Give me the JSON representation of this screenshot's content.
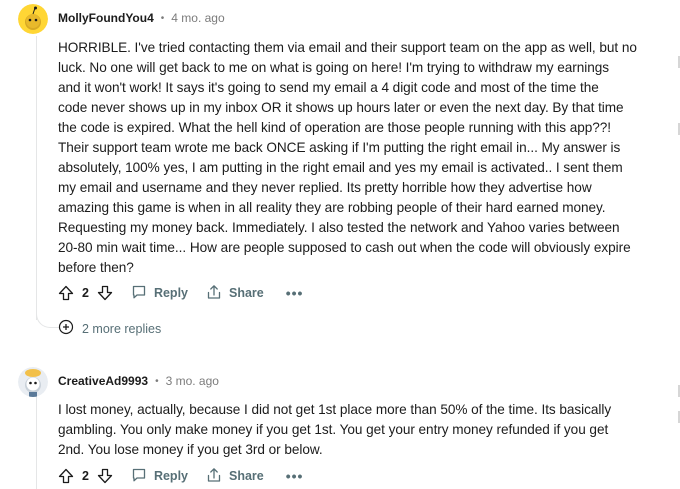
{
  "comments": [
    {
      "username": "MollyFoundYou4",
      "separator": "•",
      "time": "4 mo. ago",
      "avatar_icon": "yellow-snoo-avatar-icon",
      "body": "HORRIBLE. I've tried contacting them via email and their support team on the app as well, but no\nluck. No one will get back to me on what is going on here! I'm trying to withdraw my earnings\nand it won't work! It says it's going to send my email a 4 digit code and most of the time the\ncode never shows up in my inbox OR it shows up hours later or even the next day. By that time\nthe code is expired. What the hell kind of operation are those people running with this app??!\nTheir support team wrote me back ONCE asking if I'm putting the right email in... My answer is\nabsolutely, 100% yes, I am putting in the right email and yes my email is activated.. I sent them\nmy email and username and they never replied. Its pretty horrible how they advertise how\namazing this game is when in all reality they are robbing people of their hard earned money.\nRequesting my money back. Immediately. I also tested the network and Yahoo varies between\n20-80 min wait time... How are people supposed to cash out when the code will obviously expire\nbefore then?",
      "votes": "2",
      "reply_label": "Reply",
      "share_label": "Share",
      "more_label": "•••"
    },
    {
      "username": "CreativeAd9993",
      "separator": "•",
      "time": "3 mo. ago",
      "avatar_icon": "gray-snoo-avatar-icon",
      "body": "I lost money, actually, because I did not get 1st place more than 50% of the time. Its basically\ngambling. You only make money if you get 1st. You get your entry money refunded if you get\n2nd. You lose money if you get 3rd or below.",
      "votes": "2",
      "reply_label": "Reply",
      "share_label": "Share",
      "more_label": "•••"
    }
  ],
  "more_replies_label": "2 more replies",
  "colors": {
    "meta_gray": "#576f76",
    "time_gray": "#7c7c7c",
    "thread_line": "#e5e6e7",
    "avatar1_bg": "#ffd635",
    "avatar2_bg": "#e9edf2"
  }
}
